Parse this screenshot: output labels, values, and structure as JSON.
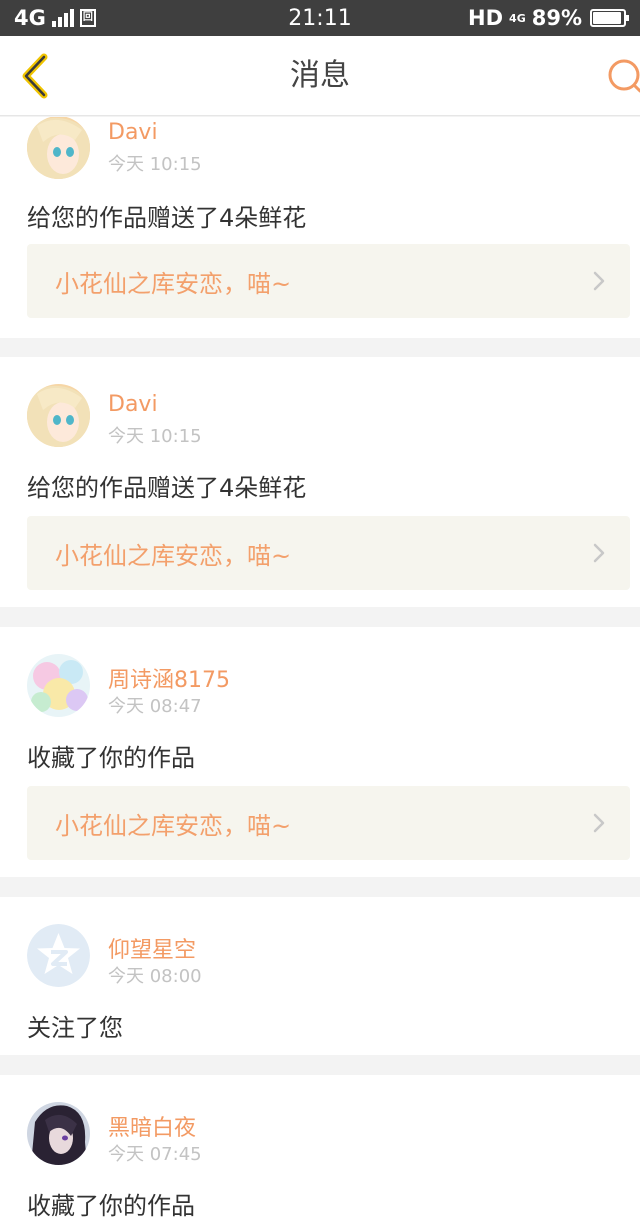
{
  "status_bar": {
    "network": "4G",
    "time": "21:11",
    "hd": "HD",
    "net_small": "4G",
    "battery": "89%"
  },
  "header": {
    "title": "消息",
    "back_icon": "chevron-left-icon",
    "search_icon": "search-icon"
  },
  "colors": {
    "accent": "#f39a63",
    "back_chevron": "#f0c400",
    "link_bg": "#f6f5ee",
    "separator": "#f3f3f3"
  },
  "messages": [
    {
      "user": "Davi",
      "time": "今天 10:15",
      "action": "给您的作品赠送了4朵鲜花",
      "work": "小花仙之库安恋，喵~"
    },
    {
      "user": "Davi",
      "time": "今天 10:15",
      "action": "给您的作品赠送了4朵鲜花",
      "work": "小花仙之库安恋，喵~"
    },
    {
      "user": "周诗涵8175",
      "time": "今天 08:47",
      "action": "收藏了你的作品",
      "work": "小花仙之库安恋，喵~"
    },
    {
      "user": "仰望星空",
      "time": "今天 08:00",
      "action": "关注了您"
    },
    {
      "user": "黑暗白夜",
      "time": "今天 07:45",
      "action": "收藏了你的作品"
    }
  ]
}
